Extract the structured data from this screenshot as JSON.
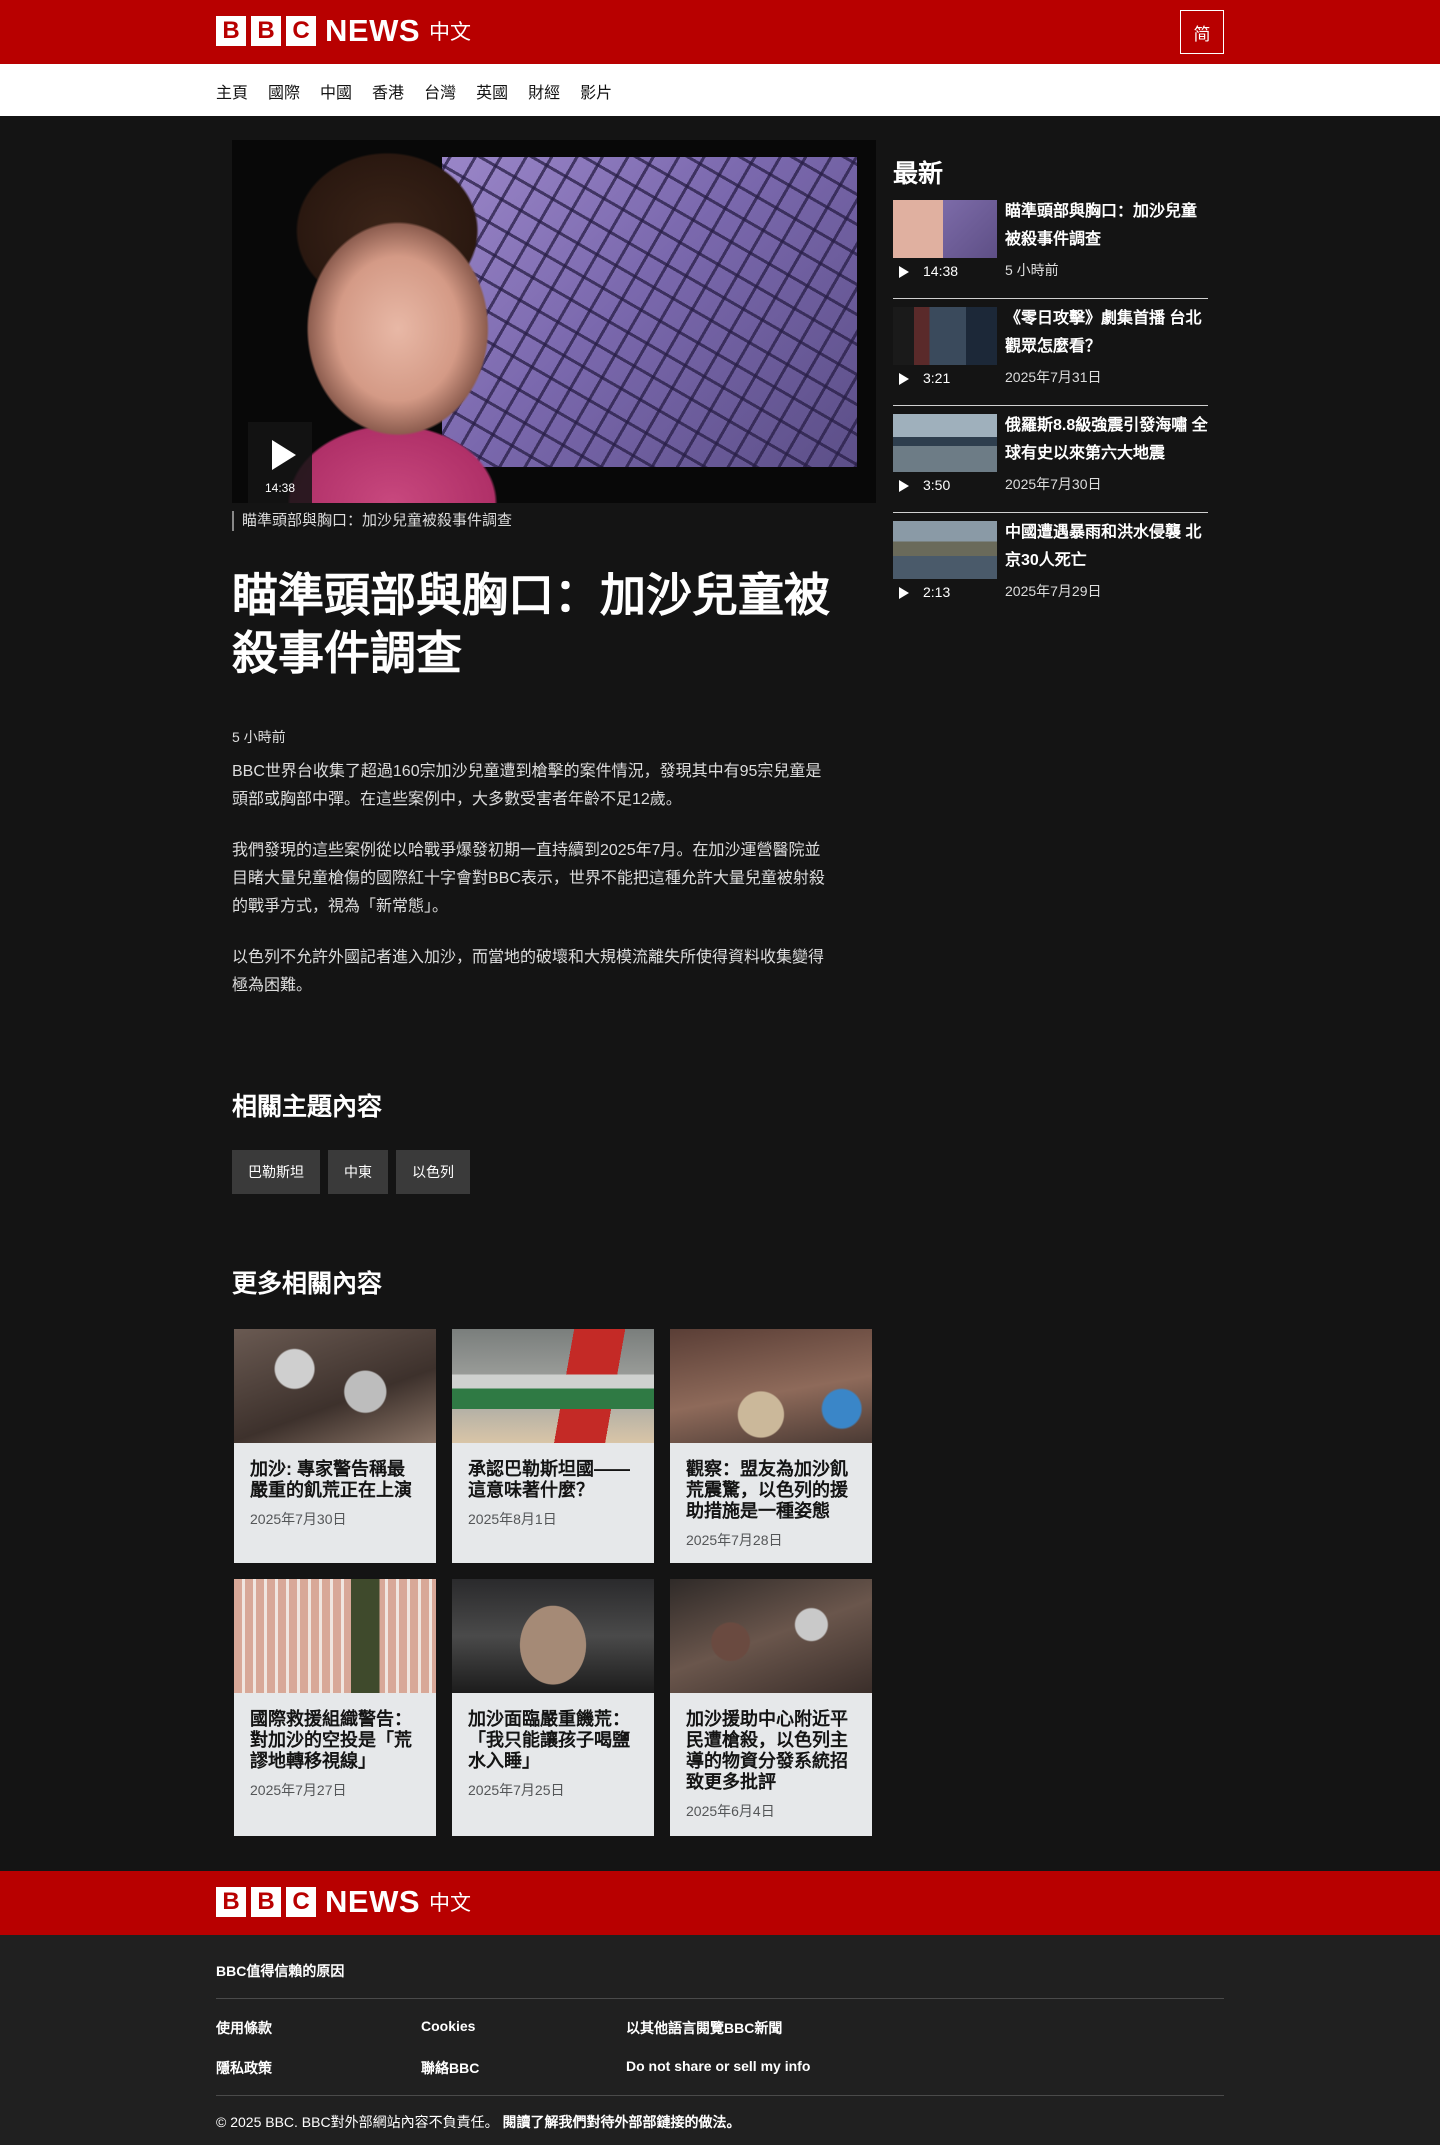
{
  "header": {
    "logo_letters": [
      "B",
      "B",
      "C"
    ],
    "logo_news": "NEWS",
    "logo_lang": "中文",
    "script_toggle": "简",
    "brand_color": "#b80000"
  },
  "nav": {
    "items": [
      "主頁",
      "國際",
      "中國",
      "香港",
      "台灣",
      "英國",
      "財經",
      "影片"
    ]
  },
  "lead": {
    "video_duration": "14:38",
    "caption": "瞄準頭部與胸口：加沙兒童被殺事件調查",
    "headline": "瞄準頭部與胸口：加沙兒童被殺事件調查",
    "timestamp": "5 小時前",
    "paragraphs": [
      "BBC世界台收集了超過160宗加沙兒童遭到槍擊的案件情況，發現其中有95宗兒童是頭部或胸部中彈。在這些案例中，大多數受害者年齡不足12歲。",
      "我們發現的這些案例從以哈戰爭爆發初期一直持續到2025年7月。在加沙運營醫院並目睹大量兒童槍傷的國際紅十字會對BBC表示，世界不能把這種允許大量兒童被射殺的戰爭方式，視為「新常態」。",
      "以色列不允許外國記者進入加沙，而當地的破壞和大規模流離失所使得資料收集變得極為困難。"
    ]
  },
  "related_topics": {
    "title": "相關主題內容",
    "tags": [
      "巴勒斯坦",
      "中東",
      "以色列"
    ]
  },
  "more_related": {
    "title": "更多相關內容",
    "cards": [
      {
        "title": "加沙: 專家警告稱最嚴重的飢荒正在上演",
        "date": "2025年7月30日"
      },
      {
        "title": "承認巴勒斯坦國——這意味著什麼？",
        "date": "2025年8月1日"
      },
      {
        "title": "觀察：盟友為加沙飢荒震驚，以色列的援助措施是一種姿態",
        "date": "2025年7月28日"
      },
      {
        "title": "國際救援組織警告：對加沙的空投是「荒謬地轉移視線」",
        "date": "2025年7月27日"
      },
      {
        "title": "加沙面臨嚴重饑荒：「我只能讓孩子喝鹽水入睡」",
        "date": "2025年7月25日"
      },
      {
        "title": "加沙援助中心附近平民遭槍殺，以色列主導的物資分發系統招致更多批評",
        "date": "2025年6月4日"
      }
    ]
  },
  "sidebar": {
    "title": "最新",
    "items": [
      {
        "title": "瞄準頭部與胸口：加沙兒童被殺事件調查",
        "date": "5 小時前",
        "duration": "14:38"
      },
      {
        "title": "《零日攻擊》劇集首播 台北觀眾怎麼看？",
        "date": "2025年7月31日",
        "duration": "3:21"
      },
      {
        "title": "俄羅斯8.8級強震引發海嘯 全球有史以來第六大地震",
        "date": "2025年7月30日",
        "duration": "3:50"
      },
      {
        "title": "中國遭遇暴雨和洪水侵襲 北京30人死亡",
        "date": "2025年7月29日",
        "duration": "2:13"
      }
    ]
  },
  "footer": {
    "trust_link": "BBC值得信賴的原因",
    "links": [
      "使用條款",
      "Cookies",
      "以其他語言閱覽BBC新聞",
      "隱私政策",
      "聯絡BBC",
      "Do not share or sell my info"
    ],
    "copyright": "© 2025 BBC. BBC對外部網站內容不負責任。",
    "external_policy": "閱讀了解我們對待外部部鏈接的做法。"
  }
}
